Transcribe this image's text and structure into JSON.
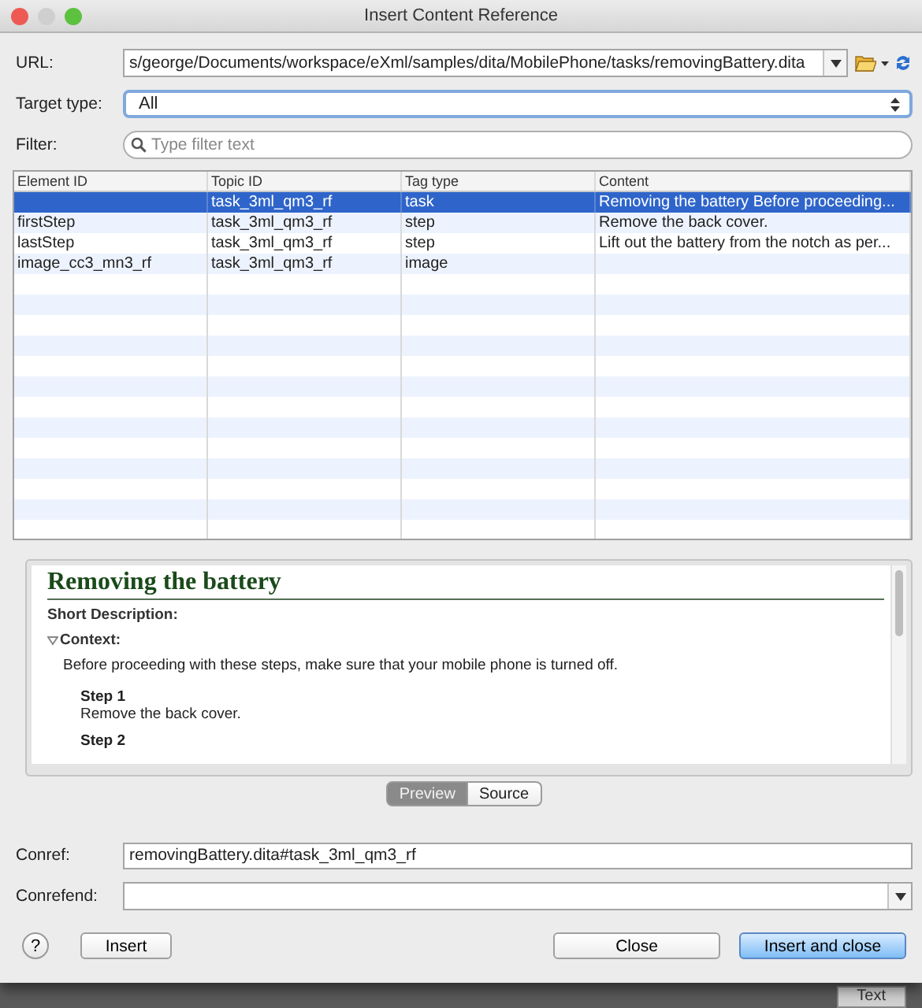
{
  "window": {
    "title": "Insert Content Reference"
  },
  "url": {
    "label": "URL:",
    "value": "s/george/Documents/workspace/eXml/samples/dita/MobilePhone/tasks/removingBattery.dita"
  },
  "target_type": {
    "label": "Target type:",
    "value": "All"
  },
  "filter": {
    "label": "Filter:",
    "placeholder": "Type filter text"
  },
  "table": {
    "columns": [
      "Element ID",
      "Topic ID",
      "Tag type",
      "Content"
    ],
    "rows": [
      {
        "cells": [
          "",
          "task_3ml_qm3_rf",
          "task",
          "Removing the battery Before proceeding..."
        ],
        "selected": true
      },
      {
        "cells": [
          "firstStep",
          "task_3ml_qm3_rf",
          "step",
          "Remove the back cover."
        ],
        "selected": false
      },
      {
        "cells": [
          "lastStep",
          "task_3ml_qm3_rf",
          "step",
          "Lift out the battery from the notch as per..."
        ],
        "selected": false
      },
      {
        "cells": [
          "image_cc3_mn3_rf",
          "task_3ml_qm3_rf",
          "image",
          ""
        ],
        "selected": false
      }
    ]
  },
  "preview": {
    "heading": "Removing the battery",
    "blocks": [
      {
        "kind": "label",
        "text": "Short Description:"
      },
      {
        "kind": "toggle",
        "text": "Context:",
        "expanded": true
      },
      {
        "kind": "para",
        "text": "Before proceeding with these steps, make sure that your mobile phone is turned off."
      },
      {
        "kind": "step",
        "title": "Step 1",
        "text": "Remove the back cover."
      },
      {
        "kind": "step",
        "title": "Step 2"
      }
    ]
  },
  "view_tabs": [
    {
      "label": "Preview",
      "selected": true
    },
    {
      "label": "Source",
      "selected": false
    }
  ],
  "conref": {
    "label": "Conref:",
    "value": "removingBattery.dita#task_3ml_qm3_rf"
  },
  "conrefend": {
    "label": "Conrefend:"
  },
  "buttons": {
    "left": [
      {
        "kind": "help",
        "label": "?"
      },
      {
        "kind": "push",
        "label": "Insert"
      }
    ],
    "right": [
      {
        "kind": "push",
        "label": "Close"
      },
      {
        "kind": "default",
        "label": "Insert and close"
      }
    ]
  },
  "background_tab": "Text"
}
